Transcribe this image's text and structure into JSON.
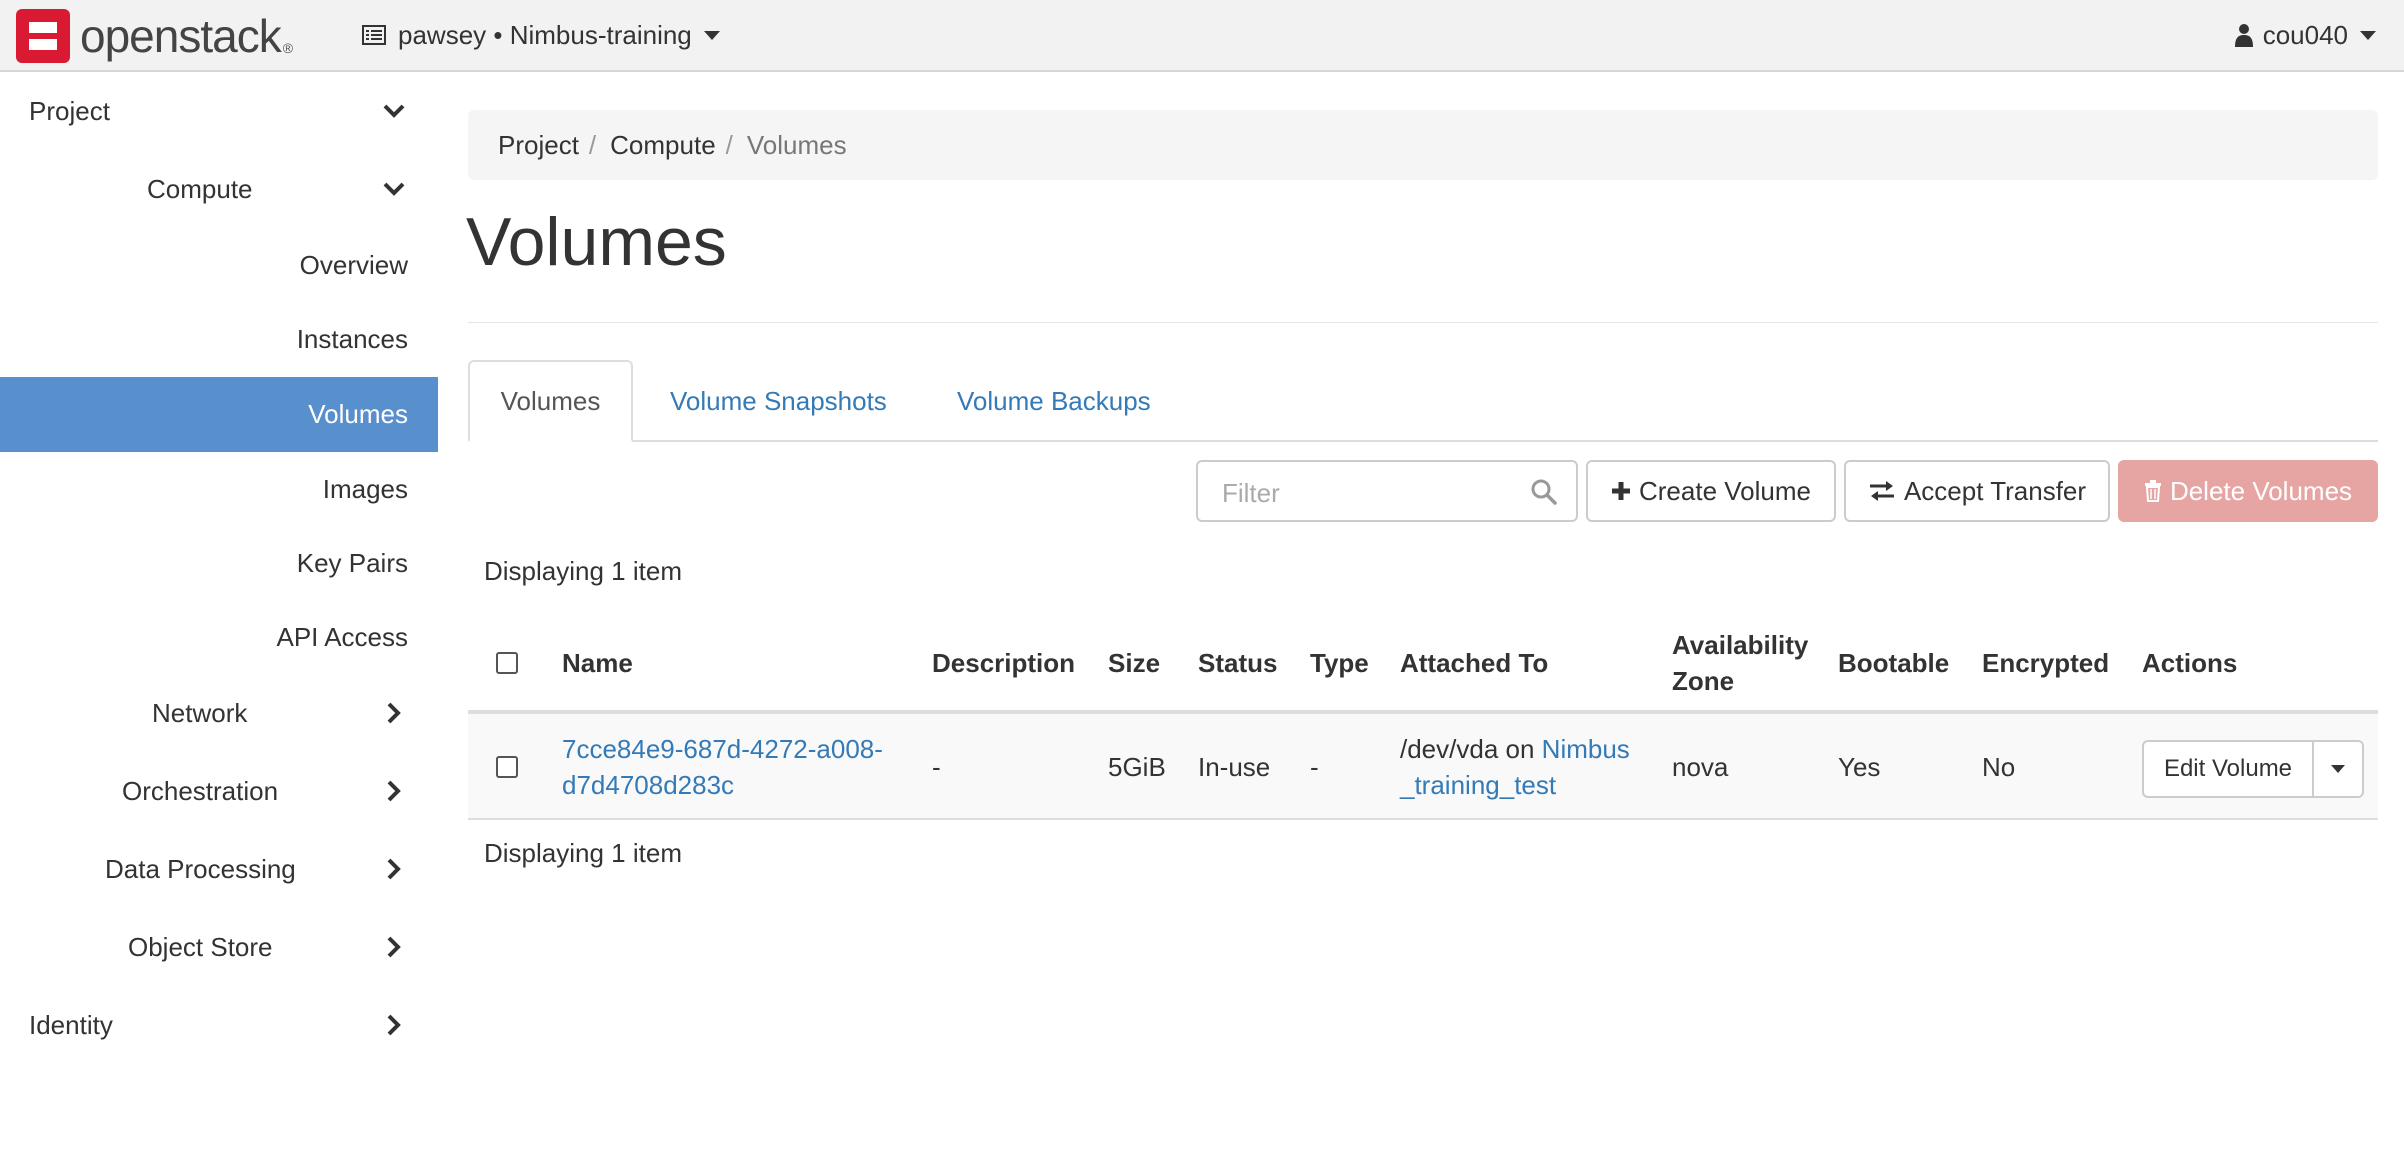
{
  "navbar": {
    "brand": "openstack",
    "brand_reg": "®",
    "project_selector": "pawsey • Nimbus-training",
    "user": "cou040"
  },
  "sidebar": {
    "project": "Project",
    "compute": "Compute",
    "compute_items": [
      "Overview",
      "Instances",
      "Volumes",
      "Images",
      "Key Pairs",
      "API Access"
    ],
    "active_item": "Volumes",
    "sections": [
      "Network",
      "Orchestration",
      "Data Processing",
      "Object Store"
    ],
    "identity": "Identity"
  },
  "breadcrumb": [
    "Project",
    "Compute",
    "Volumes"
  ],
  "page_title": "Volumes",
  "tabs": [
    "Volumes",
    "Volume Snapshots",
    "Volume Backups"
  ],
  "toolbar": {
    "filter_placeholder": "Filter",
    "create_label": "Create Volume",
    "accept_label": "Accept Transfer",
    "delete_label": "Delete Volumes"
  },
  "display_count": "Displaying 1 item",
  "table": {
    "headers": {
      "name": "Name",
      "description": "Description",
      "size": "Size",
      "status": "Status",
      "type": "Type",
      "attached_to": "Attached To",
      "availability_zone_1": "Availability",
      "availability_zone_2": "Zone",
      "bootable": "Bootable",
      "encrypted": "Encrypted",
      "actions": "Actions"
    },
    "rows": [
      {
        "name_line1": "7cce84e9-687d-4272-a008-",
        "name_line2": "d7d4708d283c",
        "description": "-",
        "size": "5GiB",
        "status": "In-use",
        "type": "-",
        "attached_prefix": "/dev/vda on",
        "attached_link_1": "Nimbus",
        "attached_link_2": "_training_test",
        "availability_zone": "nova",
        "bootable": "Yes",
        "encrypted": "No",
        "action_label": "Edit Volume"
      }
    ]
  },
  "colors": {
    "accent": "#5890ce",
    "link": "#337ab7",
    "danger_disabled": "#e6a5a3",
    "logo_red": "#da1a32"
  }
}
